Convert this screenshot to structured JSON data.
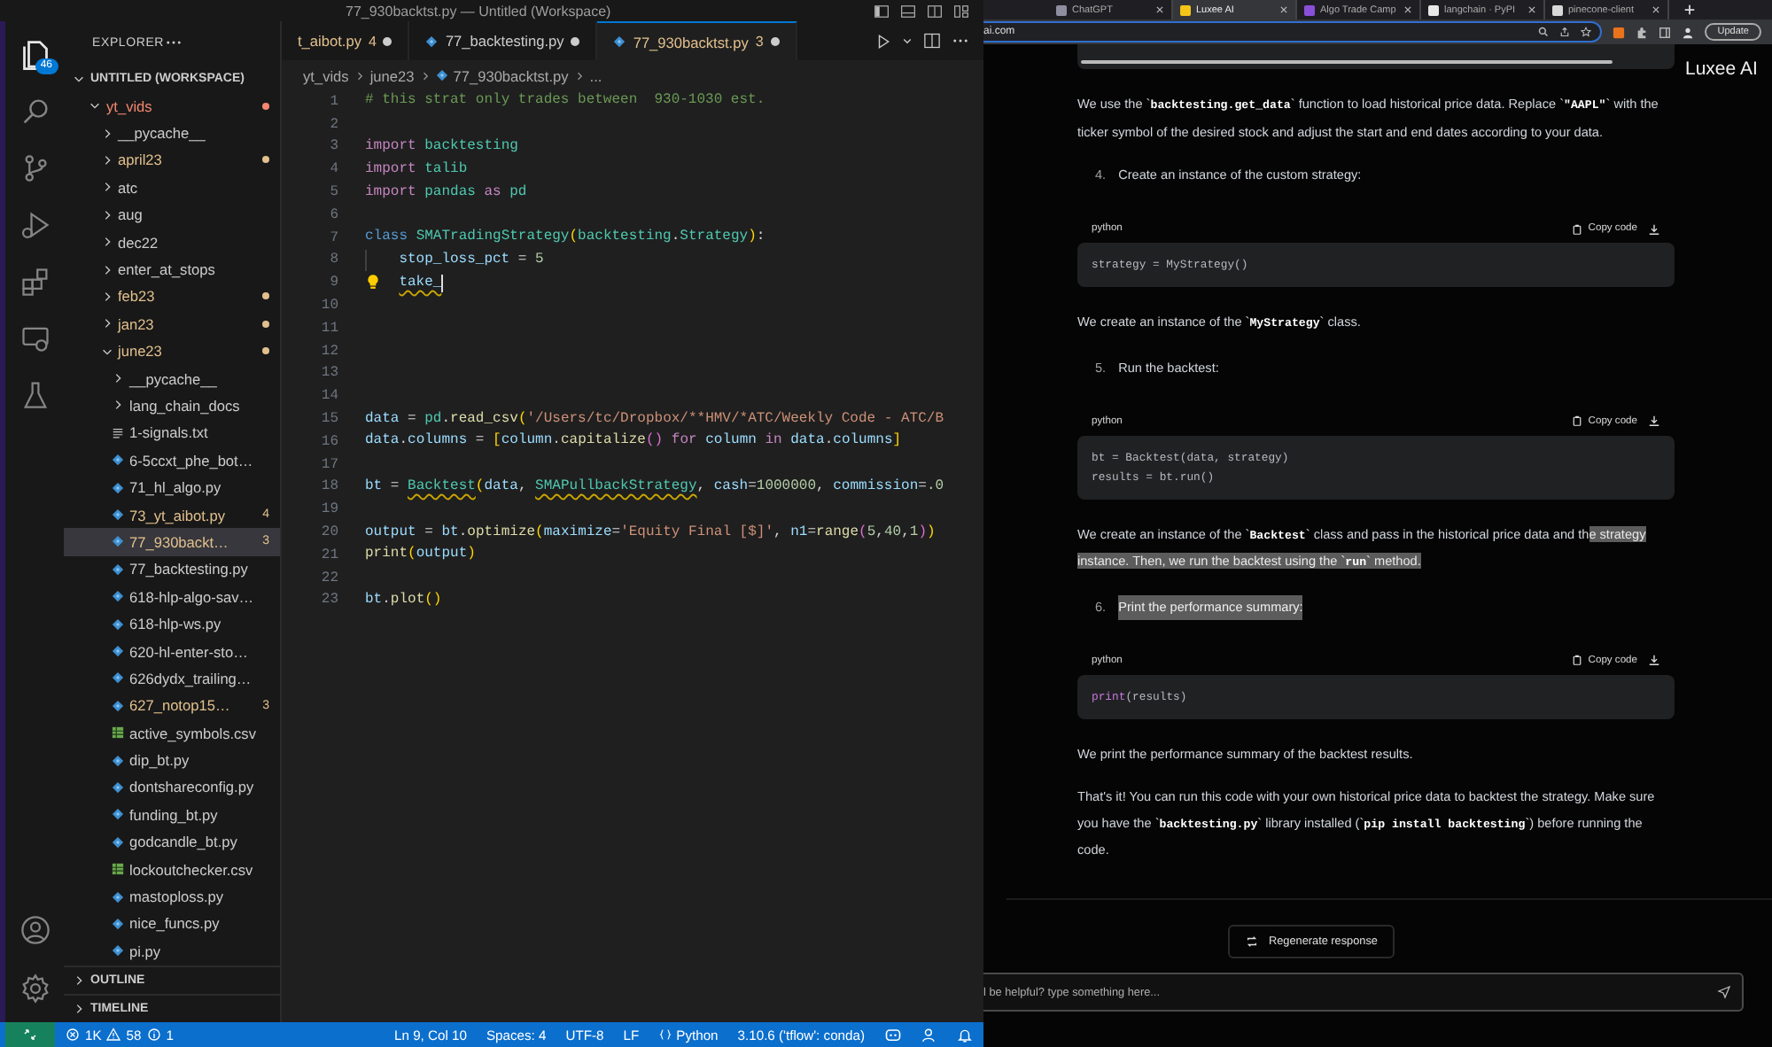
{
  "vscode": {
    "title": "77_930backtst.py — Untitled (Workspace)",
    "activity_bar": {
      "explorer_badge": "46"
    },
    "explorer": {
      "title": "EXPLORER",
      "workspace": "UNTITLED (WORKSPACE)",
      "tree": [
        {
          "name": "yt_vids",
          "kind": "folder",
          "expanded": true,
          "modified": false,
          "error": true,
          "selected": false,
          "children": [
            {
              "name": "__pycache__",
              "kind": "folder",
              "expanded": false,
              "modified": false,
              "error": false,
              "selected": false
            },
            {
              "name": "april23",
              "kind": "folder",
              "expanded": false,
              "modified": true,
              "error": false,
              "selected": false
            },
            {
              "name": "atc",
              "kind": "folder",
              "expanded": false,
              "modified": false,
              "error": false,
              "selected": false
            },
            {
              "name": "aug",
              "kind": "folder",
              "expanded": false,
              "modified": false,
              "error": false,
              "selected": false
            },
            {
              "name": "dec22",
              "kind": "folder",
              "expanded": false,
              "modified": false,
              "error": false,
              "selected": false
            },
            {
              "name": "enter_at_stops",
              "kind": "folder",
              "expanded": false,
              "modified": false,
              "error": false,
              "selected": false
            },
            {
              "name": "feb23",
              "kind": "folder",
              "expanded": false,
              "modified": true,
              "error": false,
              "selected": false
            },
            {
              "name": "jan23",
              "kind": "folder",
              "expanded": false,
              "modified": true,
              "error": false,
              "selected": false
            },
            {
              "name": "june23",
              "kind": "folder",
              "expanded": true,
              "modified": true,
              "error": false,
              "selected": false,
              "children": [
                {
                  "name": "__pycache__",
                  "kind": "folder",
                  "expanded": false,
                  "modified": false,
                  "error": false,
                  "selected": false
                },
                {
                  "name": "lang_chain_docs",
                  "kind": "folder",
                  "expanded": false,
                  "modified": false,
                  "error": false,
                  "selected": false
                },
                {
                  "name": "1-signals.txt",
                  "kind": "text",
                  "modified": false,
                  "error": false,
                  "selected": false
                },
                {
                  "name": "6-5ccxt_phe_bot…",
                  "kind": "python",
                  "modified": false,
                  "error": false,
                  "selected": false
                },
                {
                  "name": "71_hl_algo.py",
                  "kind": "python",
                  "modified": false,
                  "error": false,
                  "selected": false
                },
                {
                  "name": "73_yt_aibot.py",
                  "kind": "python",
                  "modified": true,
                  "error": false,
                  "badge": "4",
                  "selected": false
                },
                {
                  "name": "77_930backt…",
                  "kind": "python",
                  "modified": true,
                  "error": false,
                  "badge": "3",
                  "selected": true
                },
                {
                  "name": "77_backtesting.py",
                  "kind": "python",
                  "modified": false,
                  "error": false,
                  "selected": false
                },
                {
                  "name": "618-hlp-algo-sav…",
                  "kind": "python",
                  "modified": false,
                  "error": false,
                  "selected": false
                },
                {
                  "name": "618-hlp-ws.py",
                  "kind": "python",
                  "modified": false,
                  "error": false,
                  "selected": false
                },
                {
                  "name": "620-hl-enter-sto…",
                  "kind": "python",
                  "modified": false,
                  "error": false,
                  "selected": false
                },
                {
                  "name": "626dydx_trailing…",
                  "kind": "python",
                  "modified": false,
                  "error": false,
                  "selected": false
                },
                {
                  "name": "627_notop15…",
                  "kind": "python",
                  "modified": true,
                  "error": false,
                  "badge": "3",
                  "selected": false
                },
                {
                  "name": "active_symbols.csv",
                  "kind": "csv",
                  "modified": false,
                  "error": false,
                  "selected": false
                },
                {
                  "name": "dip_bt.py",
                  "kind": "python",
                  "modified": false,
                  "error": false,
                  "selected": false
                },
                {
                  "name": "dontshareconfig.py",
                  "kind": "python",
                  "modified": false,
                  "error": false,
                  "selected": false
                },
                {
                  "name": "funding_bt.py",
                  "kind": "python",
                  "modified": false,
                  "error": false,
                  "selected": false
                },
                {
                  "name": "godcandle_bt.py",
                  "kind": "python",
                  "modified": false,
                  "error": false,
                  "selected": false
                },
                {
                  "name": "lockoutchecker.csv",
                  "kind": "csv",
                  "modified": false,
                  "error": false,
                  "selected": false
                },
                {
                  "name": "mastoploss.py",
                  "kind": "python",
                  "modified": false,
                  "error": false,
                  "selected": false
                },
                {
                  "name": "nice_funcs.py",
                  "kind": "python",
                  "modified": false,
                  "error": false,
                  "selected": false
                },
                {
                  "name": "pi.py",
                  "kind": "python",
                  "modified": false,
                  "error": false,
                  "selected": false
                }
              ]
            }
          ]
        }
      ]
    },
    "sections": [
      {
        "label": "OUTLINE",
        "expanded": false
      },
      {
        "label": "TIMELINE",
        "expanded": false
      }
    ],
    "tabs": [
      {
        "label": "t_aibot.py",
        "badge": "4",
        "modified": true,
        "dirty": true,
        "selected": false
      },
      {
        "label": "77_backtesting.py",
        "modified": false,
        "dirty": true,
        "selected": false
      },
      {
        "label": "77_930backtst.py",
        "badge": "3",
        "modified": true,
        "dirty": true,
        "selected": true
      }
    ],
    "breadcrumb": [
      "yt_vids",
      "june23",
      "77_930backtst.py",
      "..."
    ],
    "code": [
      {
        "number": "1",
        "tokens": [
          {
            "text": "# this strat only trades between  930-1030 est.",
            "kind": "comment"
          }
        ]
      },
      {
        "number": "2"
      },
      {
        "number": "3",
        "tokens": [
          {
            "text": "import",
            "kind": "keyword"
          },
          {
            "text": " backtesting",
            "kind": "module"
          }
        ]
      },
      {
        "number": "4",
        "tokens": [
          {
            "text": "import",
            "kind": "keyword"
          },
          {
            "text": " talib",
            "kind": "module"
          }
        ]
      },
      {
        "number": "5",
        "tokens": [
          {
            "text": "import",
            "kind": "keyword"
          },
          {
            "text": " pandas ",
            "kind": "module"
          },
          {
            "text": "as",
            "kind": "keyword"
          },
          {
            "text": " pd",
            "kind": "module"
          }
        ]
      },
      {
        "number": "6"
      },
      {
        "number": "7",
        "tokens": [
          {
            "text": "class",
            "kind": "storage"
          },
          {
            "text": " SMATradingStrategy",
            "kind": "class"
          },
          {
            "text": "(",
            "kind": "bracket"
          },
          {
            "text": "backtesting",
            "kind": "module"
          },
          {
            "text": ".",
            "kind": "plain"
          },
          {
            "text": "Strategy",
            "kind": "class"
          },
          {
            "text": ")",
            "kind": "bracket"
          },
          {
            "text": ":",
            "kind": "plain"
          }
        ]
      },
      {
        "number": "8",
        "indented": true,
        "tokens": [
          {
            "text": "stop_loss_pct",
            "kind": "variable"
          },
          {
            "text": " = ",
            "kind": "plain"
          },
          {
            "text": "5",
            "kind": "number"
          }
        ]
      },
      {
        "number": "9",
        "indented": true,
        "lightbulb": true,
        "cursor": true,
        "tokens": [
          {
            "text": "take_",
            "kind": "variable-warning"
          }
        ]
      },
      {
        "number": "10"
      },
      {
        "number": "11"
      },
      {
        "number": "12"
      },
      {
        "number": "13"
      },
      {
        "number": "14"
      },
      {
        "number": "15",
        "tokens": [
          {
            "text": "data",
            "kind": "variable"
          },
          {
            "text": " = ",
            "kind": "plain"
          },
          {
            "text": "pd",
            "kind": "module"
          },
          {
            "text": ".",
            "kind": "plain"
          },
          {
            "text": "read_csv",
            "kind": "function"
          },
          {
            "text": "(",
            "kind": "bracket"
          },
          {
            "text": "'/Users/tc/Dropbox/**HMV/*ATC/Weekly Code - ATC/B",
            "kind": "string"
          }
        ]
      },
      {
        "number": "16",
        "tokens": [
          {
            "text": "data",
            "kind": "variable"
          },
          {
            "text": ".",
            "kind": "plain"
          },
          {
            "text": "columns",
            "kind": "variable"
          },
          {
            "text": " = ",
            "kind": "plain"
          },
          {
            "text": "[",
            "kind": "bracket"
          },
          {
            "text": "column",
            "kind": "variable"
          },
          {
            "text": ".",
            "kind": "plain"
          },
          {
            "text": "capitalize",
            "kind": "function"
          },
          {
            "text": "()",
            "kind": "bracket2"
          },
          {
            "text": " for ",
            "kind": "keyword"
          },
          {
            "text": "column",
            "kind": "variable"
          },
          {
            "text": " in ",
            "kind": "keyword"
          },
          {
            "text": "data",
            "kind": "variable"
          },
          {
            "text": ".",
            "kind": "plain"
          },
          {
            "text": "columns",
            "kind": "variable"
          },
          {
            "text": "]",
            "kind": "bracket"
          }
        ]
      },
      {
        "number": "17"
      },
      {
        "number": "18",
        "tokens": [
          {
            "text": "bt",
            "kind": "variable"
          },
          {
            "text": " = ",
            "kind": "plain"
          },
          {
            "text": "Backtest",
            "kind": "class-warning"
          },
          {
            "text": "(",
            "kind": "bracket"
          },
          {
            "text": "data",
            "kind": "variable"
          },
          {
            "text": ", ",
            "kind": "plain"
          },
          {
            "text": "SMAPullbackStrategy",
            "kind": "class-warning"
          },
          {
            "text": ", ",
            "kind": "plain"
          },
          {
            "text": "cash",
            "kind": "variable"
          },
          {
            "text": "=",
            "kind": "plain"
          },
          {
            "text": "1000000",
            "kind": "number"
          },
          {
            "text": ", ",
            "kind": "plain"
          },
          {
            "text": "commission",
            "kind": "variable"
          },
          {
            "text": "=",
            "kind": "plain"
          },
          {
            "text": ".0",
            "kind": "number"
          }
        ]
      },
      {
        "number": "19"
      },
      {
        "number": "20",
        "tokens": [
          {
            "text": "output",
            "kind": "variable"
          },
          {
            "text": " = ",
            "kind": "plain"
          },
          {
            "text": "bt",
            "kind": "variable"
          },
          {
            "text": ".",
            "kind": "plain"
          },
          {
            "text": "optimize",
            "kind": "function"
          },
          {
            "text": "(",
            "kind": "bracket"
          },
          {
            "text": "maximize",
            "kind": "variable"
          },
          {
            "text": "=",
            "kind": "plain"
          },
          {
            "text": "'Equity Final [$]'",
            "kind": "string"
          },
          {
            "text": ", ",
            "kind": "plain"
          },
          {
            "text": "n1",
            "kind": "variable"
          },
          {
            "text": "=",
            "kind": "plain"
          },
          {
            "text": "range",
            "kind": "function"
          },
          {
            "text": "(",
            "kind": "bracket2"
          },
          {
            "text": "5",
            "kind": "number"
          },
          {
            "text": ",",
            "kind": "plain"
          },
          {
            "text": "40",
            "kind": "number"
          },
          {
            "text": ",",
            "kind": "plain"
          },
          {
            "text": "1",
            "kind": "number"
          },
          {
            "text": ")",
            "kind": "bracket2"
          },
          {
            "text": ")",
            "kind": "bracket"
          }
        ]
      },
      {
        "number": "21",
        "tokens": [
          {
            "text": "print",
            "kind": "function"
          },
          {
            "text": "(",
            "kind": "bracket"
          },
          {
            "text": "output",
            "kind": "variable"
          },
          {
            "text": ")",
            "kind": "bracket"
          }
        ]
      },
      {
        "number": "22"
      },
      {
        "number": "23",
        "tokens": [
          {
            "text": "bt",
            "kind": "variable"
          },
          {
            "text": ".",
            "kind": "plain"
          },
          {
            "text": "plot",
            "kind": "function"
          },
          {
            "text": "()",
            "kind": "bracket"
          }
        ]
      }
    ],
    "status_bar": {
      "errors": "1K",
      "warnings": "58",
      "infos": "1",
      "cursor_position": "Ln 9, Col 10",
      "indentation": "Spaces: 4",
      "encoding": "UTF-8",
      "line_ending": "LF",
      "language": "Python",
      "interpreter": "3.10.6 ('tflow': conda)"
    }
  },
  "browser": {
    "tabs": [
      {
        "title": "ChatGPT",
        "color": "#8e8ea0",
        "selected": false
      },
      {
        "title": "Luxee AI",
        "color": "#f5c518",
        "selected": true
      },
      {
        "title": "Algo Trade Camp",
        "color": "#8a4fd8",
        "selected": false
      },
      {
        "title": "langchain · PyPI",
        "color": "#e8e8e8",
        "selected": false
      },
      {
        "title": "pinecone-client",
        "color": "#d8d8d8",
        "selected": false
      }
    ],
    "address": "ai.com",
    "update_button": "Update",
    "app_title": "Luxee AI",
    "messages": [
      {
        "kind": "paragraph",
        "text": "We use the `**backtesting.get_data**` function to load historical price data. Replace `**\"AAPL\"**` with the ticker symbol of the desired stock and adjust the start and end dates according to your data."
      },
      {
        "kind": "step",
        "number": "4.",
        "text": "Create an instance of the custom strategy:",
        "selected": false
      },
      {
        "kind": "code",
        "language": "python",
        "copy_label": "Copy code",
        "lines": [
          {
            "tokens": [
              {
                "text": "strategy = MyStrategy()",
                "kind": "plain"
              }
            ]
          }
        ]
      },
      {
        "kind": "paragraph",
        "text": "We create an instance of the `**MyStrategy**` class."
      },
      {
        "kind": "step",
        "number": "5.",
        "text": "Run the backtest:",
        "selected": false
      },
      {
        "kind": "code",
        "language": "python",
        "copy_label": "Copy code",
        "lines": [
          {
            "tokens": [
              {
                "text": "bt = Backtest(data, strategy)",
                "kind": "plain"
              }
            ]
          },
          {
            "tokens": [
              {
                "text": "results = bt.run()",
                "kind": "plain"
              }
            ]
          }
        ]
      },
      {
        "kind": "paragraph",
        "text": "We create an instance of the `**Backtest**` class and pass in the historical price data and th",
        "selection": "e strategy instance. Then, we run the backtest using the `**run**` method."
      },
      {
        "kind": "step",
        "number": "6.",
        "text": "Print the performance summary:",
        "selected": true
      },
      {
        "kind": "code",
        "language": "python",
        "copy_label": "Copy code",
        "lines": [
          {
            "tokens": [
              {
                "text": "print",
                "kind": "builtin"
              },
              {
                "text": "(results)",
                "kind": "plain"
              }
            ]
          }
        ]
      },
      {
        "kind": "paragraph",
        "text": "We print the performance summary of the backtest results."
      },
      {
        "kind": "paragraph",
        "text": "That's it! You can run this code with your own historical price data to backtest the strategy. Make sure you have the `**backtesting.py**` library installed (`**pip install backtesting**`) before running the code."
      }
    ],
    "regenerate_button": "Regenerate response",
    "input": {
      "placeholder": "l be helpful? type something here..."
    }
  }
}
